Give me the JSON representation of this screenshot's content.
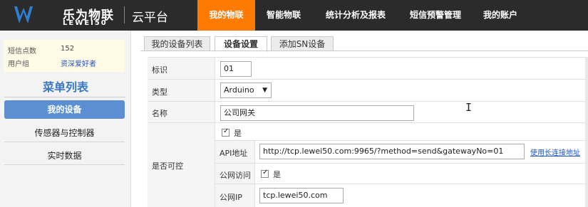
{
  "brand": {
    "name_cn": "乐为物联",
    "name_en": "LEWEI50",
    "platform": "云平台",
    "logo_color": "#2f7fd6"
  },
  "nav": {
    "accent": "#ff7a00",
    "items": [
      {
        "label": "我的物联",
        "active": true
      },
      {
        "label": "智能物联"
      },
      {
        "label": "统计分析及报表"
      },
      {
        "label": "短信预警管理"
      },
      {
        "label": "我的账户"
      }
    ]
  },
  "sidebar": {
    "sms_label": "短信点数",
    "sms_value": "152",
    "group_label": "用户组",
    "group_value": "资深爱好者",
    "menu_title": "菜单列表",
    "menu": [
      {
        "label": "我的设备",
        "active": true
      },
      {
        "label": "传感器与控制器"
      },
      {
        "label": "实时数据"
      }
    ]
  },
  "tabs": [
    {
      "label": "我的设备列表"
    },
    {
      "label": "设备设置",
      "active": true
    },
    {
      "label": "添加SN设备"
    }
  ],
  "form": {
    "id_label": "标识",
    "id_value": "01",
    "type_label": "类型",
    "type_value": "Arduino",
    "name_label": "名称",
    "name_value": "公司网关",
    "controllable_label": "是否可控",
    "controllable_check_label": "是",
    "api_label": "API地址",
    "api_value": "http://tcp.lewei50.com:9965/?method=send&gatewayNo=01",
    "long_conn_link": "使用长连接地址",
    "public_access_label": "公网访问",
    "public_access_check_label": "是",
    "public_ip_label": "公网IP",
    "public_ip_value": "tcp.lewei50.com"
  }
}
